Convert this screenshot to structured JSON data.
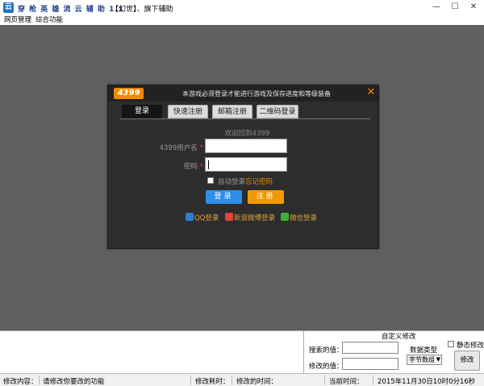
{
  "window": {
    "app_icon": "云",
    "title": "穿 枪 英 雄 流 云 辅 助 1.1",
    "title_extra": "【幻世】、旗下辅助",
    "controls": {
      "minimize": "—",
      "maximize": "☐",
      "close": "✕"
    }
  },
  "menu": [
    "网页管理",
    "综合功能"
  ],
  "login_dialog": {
    "logo": "4399",
    "notice": "本游戏必须登录才能进行游戏及保存进度和等级装备",
    "close_glyph": "✕",
    "tabs": [
      "登录",
      "快速注册",
      "邮箱注册",
      "二维码登录"
    ],
    "active_tab": 0,
    "welcome": "欢迎回到4399",
    "username_label": "4399用户名",
    "password_label": "密码",
    "required_mark": "*",
    "username_value": "",
    "password_value": "",
    "auto_login": "自动登录",
    "forgot_password": "忘记密码",
    "login_button": "登录",
    "register_button": "注册",
    "social": [
      {
        "label": "QQ登录",
        "icon": "qq-icon"
      },
      {
        "label": "新浪微博登录",
        "icon": "weibo-icon"
      },
      {
        "label": "微信登录",
        "icon": "wechat-icon"
      }
    ]
  },
  "custom_modify": {
    "title": "自定义修改",
    "search_label": "搜索的值：",
    "modify_label": "修改的值：",
    "data_type_label": "数据类型",
    "data_type_value": "字节数组",
    "static_label": "静态修改",
    "modify_button": "修改"
  },
  "status_bar": {
    "modify_content_label": "修改内容：",
    "modify_content_value": "请修改你要改的功能",
    "modify_time_label": "修改耗时：",
    "modify_time_value": "修改的时间：",
    "current_time_label": "当前时间：",
    "current_time_value": "2015年11月30日10时0分16秒"
  },
  "colors": {
    "app_area": "#5f5f5f",
    "dialog_bg": "#2d2d2d",
    "brand_orange": "#f08a00",
    "login_blue": "#2e8ee8",
    "register_orange": "#f39800"
  }
}
